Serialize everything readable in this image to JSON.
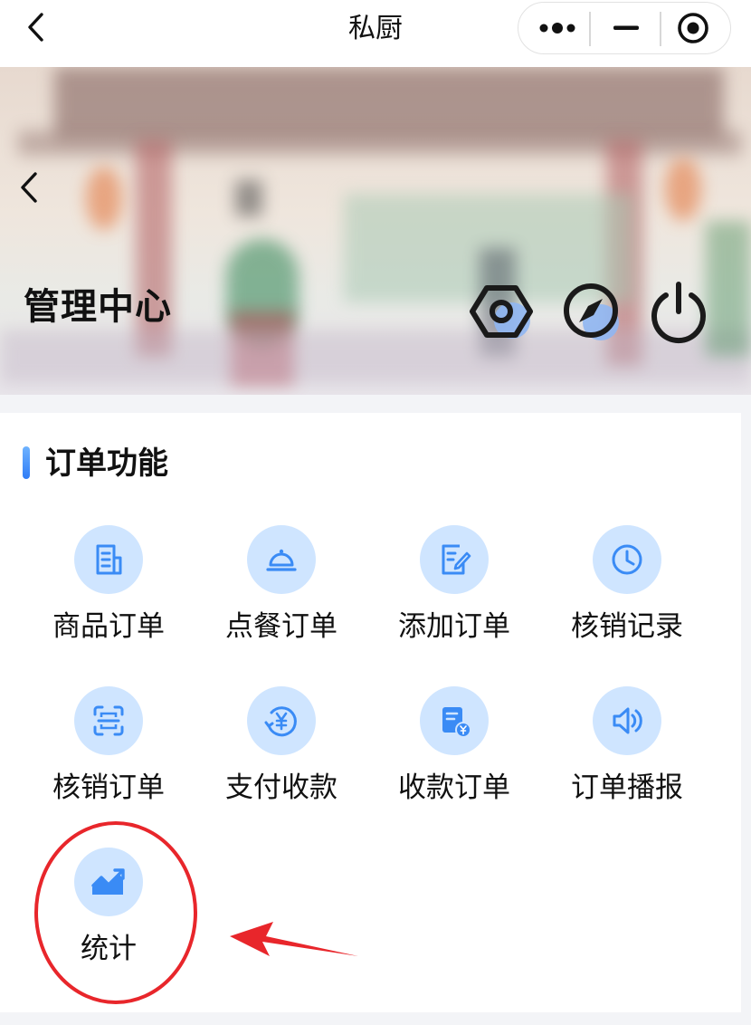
{
  "navbar": {
    "title": "私厨",
    "back_icon": "chevron-left-icon",
    "capsule": {
      "more_icon": "more-dots-icon",
      "minimize_icon": "minimize-icon",
      "close_icon": "target-close-icon"
    }
  },
  "hero": {
    "title": "管理中心",
    "back_icon": "chevron-left-icon",
    "actions": [
      {
        "name": "settings",
        "icon": "hex-nut-settings-icon"
      },
      {
        "name": "discover",
        "icon": "compass-icon"
      },
      {
        "name": "logout",
        "icon": "power-icon"
      }
    ]
  },
  "section": {
    "title": "订单功能",
    "items": [
      {
        "label": "商品订单",
        "icon": "document-icon"
      },
      {
        "label": "点餐订单",
        "icon": "cloche-icon"
      },
      {
        "label": "添加订单",
        "icon": "edit-note-icon"
      },
      {
        "label": "核销记录",
        "icon": "clock-icon"
      },
      {
        "label": "核销订单",
        "icon": "scan-icon"
      },
      {
        "label": "支付收款",
        "icon": "yuan-refresh-icon"
      },
      {
        "label": "收款订单",
        "icon": "invoice-yuan-icon"
      },
      {
        "label": "订单播报",
        "icon": "speaker-icon"
      },
      {
        "label": "统计",
        "icon": "trend-chart-icon"
      }
    ]
  },
  "colors": {
    "accent": "#2f7cf6",
    "icon_bg": "#cfe5ff",
    "annotation_red": "#e8262b"
  }
}
